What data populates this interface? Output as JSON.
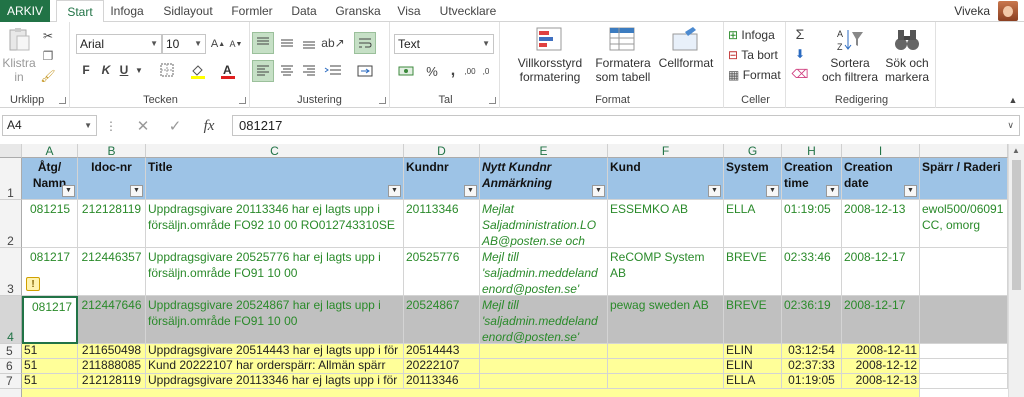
{
  "tabs": [
    "ARKIV",
    "Start",
    "Infoga",
    "Sidlayout",
    "Formler",
    "Data",
    "Granska",
    "Visa",
    "Utvecklare"
  ],
  "user": "Viveka",
  "ribbon": {
    "clipboard": {
      "paste": "Klistra in",
      "label": "Urklipp"
    },
    "font": {
      "name": "Arial",
      "size": "10",
      "label": "Tecken",
      "bold": "F",
      "italic": "K",
      "underline": "U"
    },
    "alignment": {
      "label": "Justering"
    },
    "number": {
      "format": "Text",
      "label": "Tal"
    },
    "styles": {
      "cond": "Villkorsstyrd formatering",
      "table": "Formatera som tabell",
      "cell": "Cellformat",
      "label": "Format"
    },
    "cells": {
      "insert": "Infoga",
      "delete": "Ta bort",
      "format": "Format",
      "label": "Celler"
    },
    "editing": {
      "sort": "Sortera och filtrera",
      "find": "Sök och markera",
      "label": "Redigering"
    }
  },
  "formula": {
    "namebox": "A4",
    "value": "081217"
  },
  "columns": [
    "A",
    "B",
    "C",
    "D",
    "E",
    "F",
    "G",
    "H",
    "I"
  ],
  "headers": [
    "Åtg/ Namn",
    "Idoc-nr",
    "Title",
    "Kundnr",
    "Nytt Kundnr Anmärkning",
    "Kund",
    "System",
    "Creation time",
    "Creation date",
    "Spärr / Raderi"
  ],
  "rownums": [
    "1",
    "2",
    "3",
    "4",
    "5",
    "6",
    "7"
  ],
  "rows": [
    [
      "081215",
      "212128119",
      "Uppdragsgivare 20113346 har ej lagts upp i försäljn.område FO92 10 00 RO012743310SE",
      "20113346",
      "Mejlat Saljadministration.LO AB@posten.se och",
      "ESSEMKO AB",
      "ELLA",
      "01:19:05",
      "2008-12-13",
      "ewol500/06091 CC, omorg"
    ],
    [
      "081217",
      "212446357",
      "Uppdragsgivare 20525776 har ej lagts upp i försäljn.område FO91 10 00",
      "20525776",
      "Mejl till 'saljadmin.meddeland enord@posten.se'",
      "ReCOMP System AB",
      "BREVE",
      "02:33:46",
      "2008-12-17",
      ""
    ],
    [
      "081217",
      "212447646",
      "Uppdragsgivare 20524867 har ej lagts upp i försäljn.område FO91 10 00",
      "20524867",
      "Mejl till 'saljadmin.meddeland enord@posten.se'",
      "pewag sweden AB",
      "BREVE",
      "02:36:19",
      "2008-12-17",
      ""
    ],
    [
      "51",
      "211650498",
      "Uppdragsgivare 20514443 har ej lagts upp i för",
      "20514443",
      "",
      "",
      "ELIN",
      "03:12:54",
      "2008-12-11",
      ""
    ],
    [
      "51",
      "211888085",
      "Kund 20222107 har orderspärr: Allmän spärr",
      "20222107",
      "",
      "",
      "ELIN",
      "02:37:33",
      "2008-12-12",
      ""
    ],
    [
      "51",
      "212128119",
      "Uppdragsgivare 20113346 har ej lagts upp i för",
      "20113346",
      "",
      "",
      "ELLA",
      "01:19:05",
      "2008-12-13",
      ""
    ]
  ]
}
